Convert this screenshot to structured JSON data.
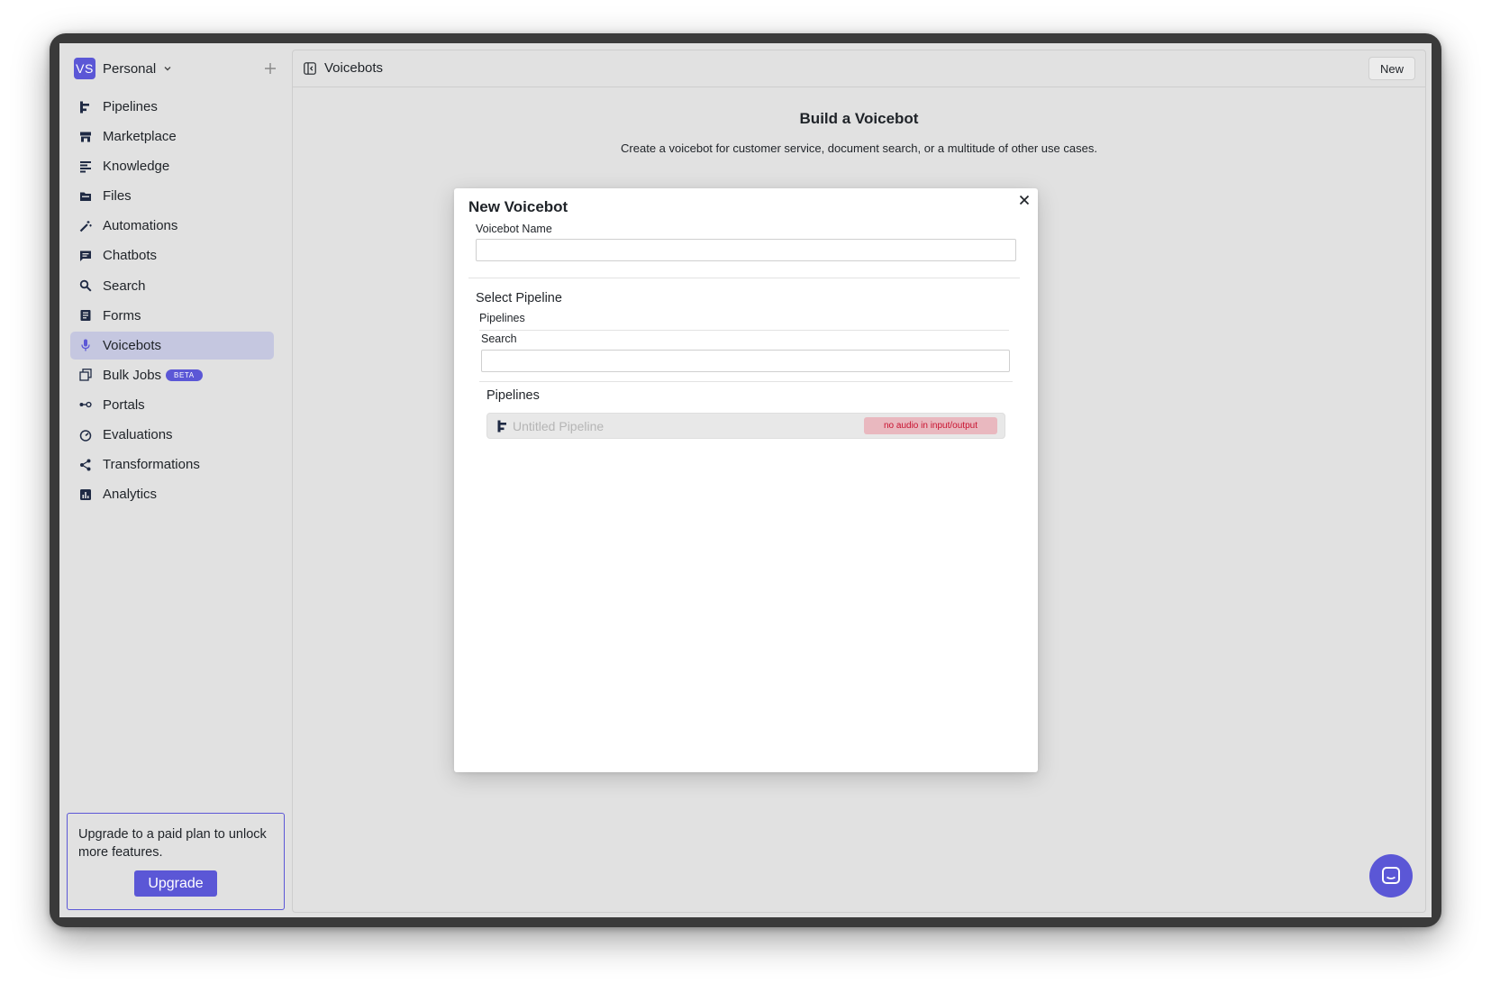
{
  "workspace": {
    "initials": "VS",
    "name": "Personal"
  },
  "sidebar": {
    "items": [
      {
        "label": "Pipelines",
        "icon": "pipeline-icon"
      },
      {
        "label": "Marketplace",
        "icon": "store-icon"
      },
      {
        "label": "Knowledge",
        "icon": "knowledge-icon"
      },
      {
        "label": "Files",
        "icon": "folder-icon"
      },
      {
        "label": "Automations",
        "icon": "wand-icon"
      },
      {
        "label": "Chatbots",
        "icon": "chat-icon"
      },
      {
        "label": "Search",
        "icon": "search-icon"
      },
      {
        "label": "Forms",
        "icon": "form-icon"
      },
      {
        "label": "Voicebots",
        "icon": "microphone-icon",
        "active": true
      },
      {
        "label": "Bulk Jobs",
        "icon": "copy-icon",
        "badge": "BETA"
      },
      {
        "label": "Portals",
        "icon": "portal-icon"
      },
      {
        "label": "Evaluations",
        "icon": "gauge-icon"
      },
      {
        "label": "Transformations",
        "icon": "share-icon"
      },
      {
        "label": "Analytics",
        "icon": "analytics-icon"
      }
    ]
  },
  "upgrade": {
    "text": "Upgrade to a paid plan to unlock more features.",
    "button": "Upgrade"
  },
  "main": {
    "title": "Voicebots",
    "new_button": "New",
    "hero_title": "Build a Voicebot",
    "hero_subtitle": "Create a voicebot for customer service, document search, or a multitude of other use cases."
  },
  "modal": {
    "title": "New Voicebot",
    "name_label": "Voicebot Name",
    "name_value": "",
    "select_title": "Select Pipeline",
    "pipelines_tab": "Pipelines",
    "search_label": "Search",
    "search_value": "",
    "list_title": "Pipelines",
    "pipelines": [
      {
        "name": "Untitled Pipeline",
        "badge": "no audio in input/output"
      }
    ]
  },
  "colors": {
    "accent": "#5b57d6",
    "active_nav": "#c5c7e0",
    "badge_bg": "#e9b8bf",
    "badge_text": "#c8102e"
  }
}
